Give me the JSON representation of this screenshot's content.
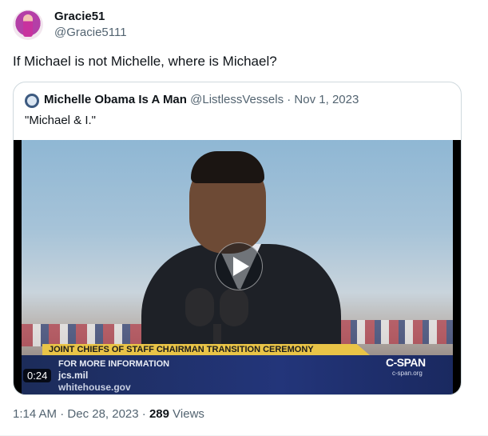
{
  "tweet": {
    "author_name": "Gracie51",
    "author_handle": "@Gracie5111",
    "text": "If Michael is not Michelle, where is Michael?",
    "avatar_icon": "profile-avatar"
  },
  "quoted": {
    "author_name": "Michelle Obama Is A Man",
    "author_handle": "@ListlessVessels",
    "separator": " · ",
    "date": "Nov 1, 2023",
    "text": "\"Michael & I.\"",
    "video": {
      "duration": "0:24",
      "banner": "JOINT CHIEFS OF STAFF CHAIRMAN TRANSITION CEREMONY",
      "info_heading": "FOR MORE INFORMATION",
      "info_line1": "jcs.mil",
      "info_line2": "whitehouse.gov",
      "network": "C-SPAN",
      "network_site": "c-span.org",
      "play_icon": "play-icon"
    }
  },
  "footer": {
    "time": "1:14 AM",
    "sep1": " · ",
    "date": "Dec 28, 2023",
    "sep2": " · ",
    "views": "289",
    "views_label": " Views"
  },
  "colors": {
    "text": "#0f1419",
    "muted": "#536471",
    "border": "#cfd9de"
  }
}
